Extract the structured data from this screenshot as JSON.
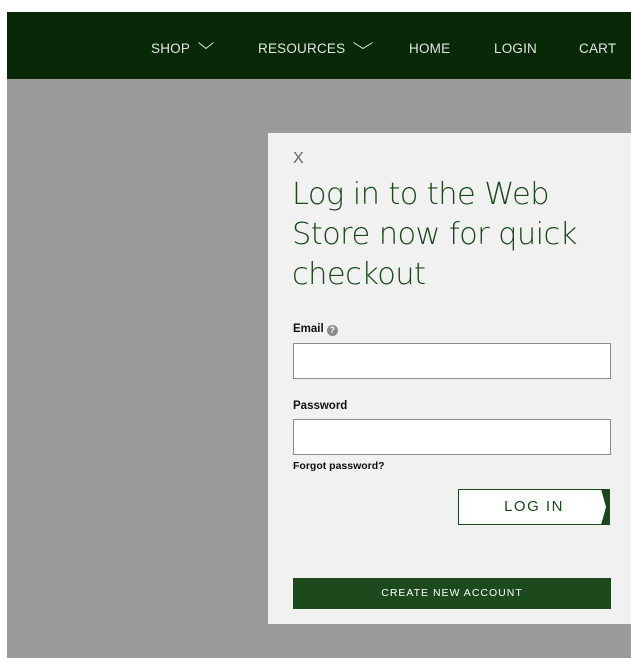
{
  "nav": {
    "items": [
      {
        "label": "SHOP",
        "has_dropdown": true
      },
      {
        "label": "RESOURCES",
        "has_dropdown": true
      },
      {
        "label": "HOME",
        "has_dropdown": false
      },
      {
        "label": "LOGIN",
        "has_dropdown": false
      },
      {
        "label": "CART",
        "has_dropdown": false
      }
    ]
  },
  "modal": {
    "close_label": "X",
    "heading": "Log in to the Web Store now for quick checkout",
    "email_label": "Email",
    "email_value": "",
    "email_help_icon": "question-circle-icon",
    "password_label": "Password",
    "password_value": "",
    "forgot_password": "Forgot password?",
    "login_button": "LOG IN",
    "create_account_button": "CREATE NEW ACCOUNT"
  },
  "colors": {
    "nav_background": "#082808",
    "brand_green": "#1c461c",
    "overlay": "#9b9b9b",
    "modal_background": "#f1f1f1"
  }
}
